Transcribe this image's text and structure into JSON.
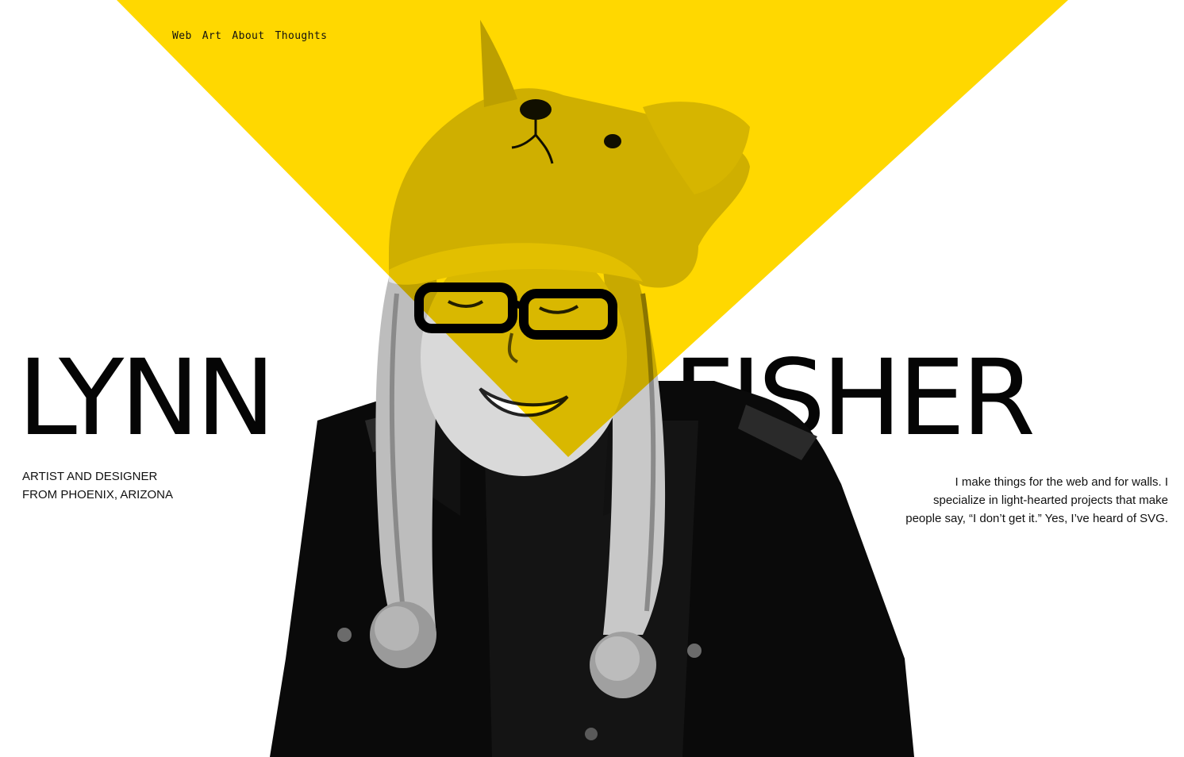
{
  "nav": {
    "items": [
      {
        "label": "Web"
      },
      {
        "label": "Art"
      },
      {
        "label": "About"
      },
      {
        "label": "Thoughts"
      }
    ]
  },
  "hero": {
    "first_name": "LYNN",
    "last_name": "FISHER",
    "tagline_lines": [
      "ARTIST AND DESIGNER",
      "FROM PHOENIX, ARIZONA"
    ],
    "bio_lines": [
      "I make things for the web and for walls. I",
      "specialize in light-hearted projects that make",
      "people say, “I don’t get it.” Yes, I’ve heard of SVG."
    ]
  },
  "colors": {
    "accent": "#FFD800",
    "text": "#050505",
    "background": "#ffffff"
  },
  "icons": {
    "portrait": "portrait-photo"
  }
}
